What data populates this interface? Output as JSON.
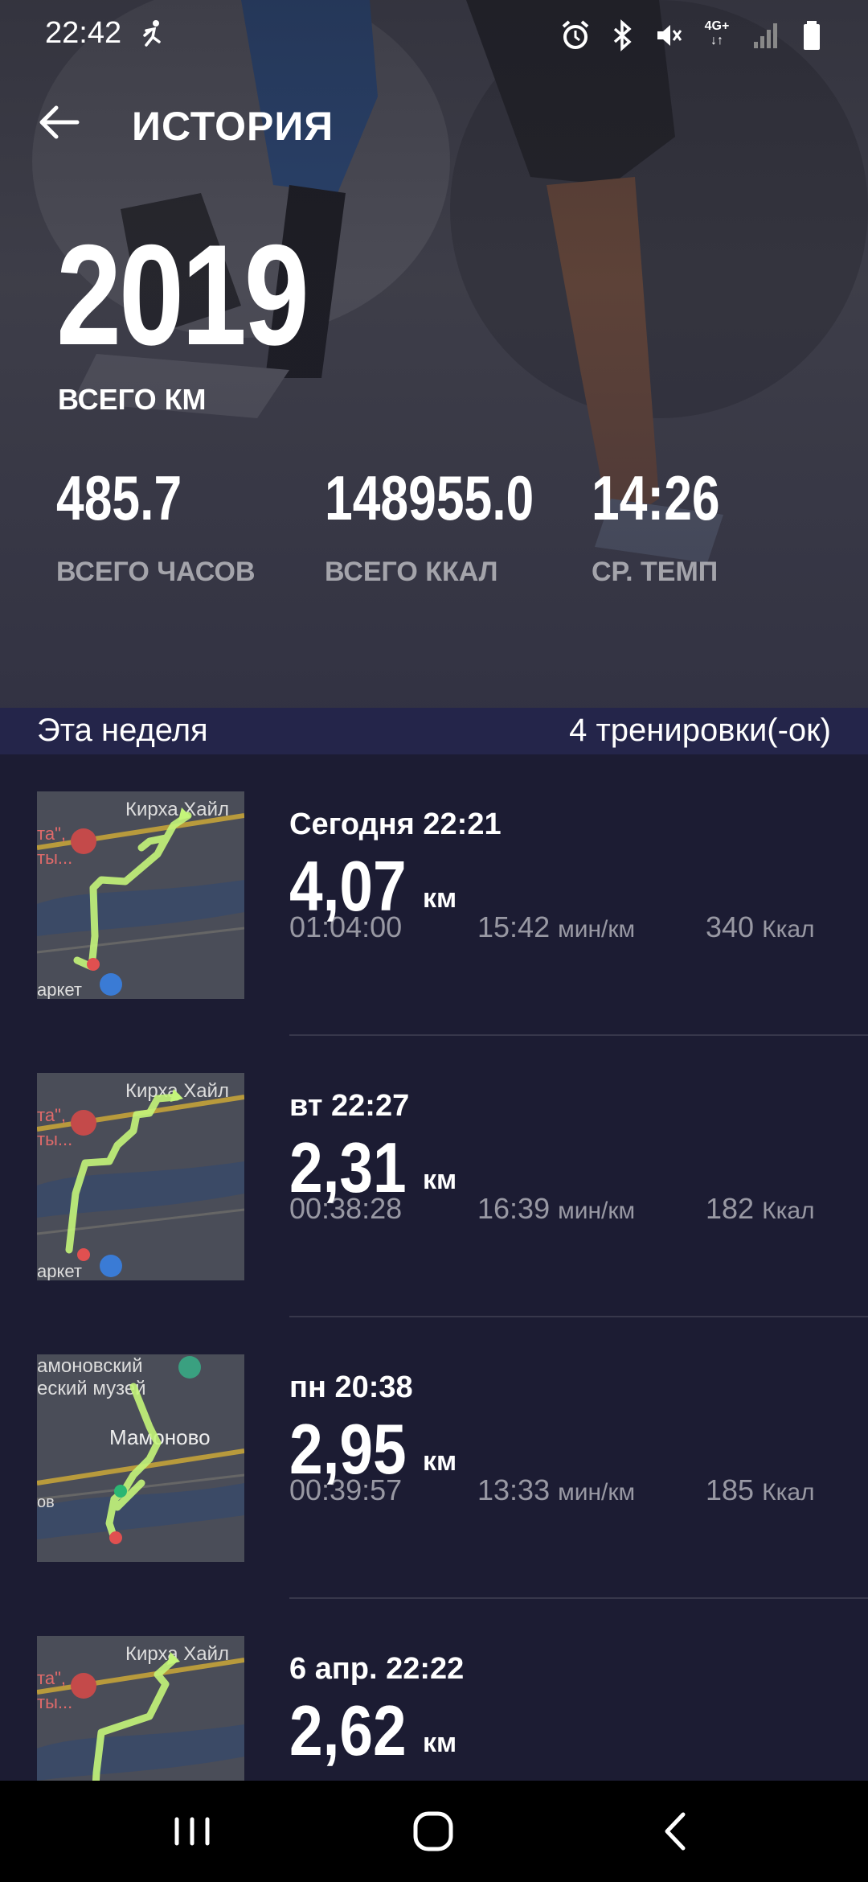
{
  "status_bar": {
    "time": "22:42",
    "network": "4G+",
    "icons": [
      "running-icon",
      "alarm-icon",
      "bluetooth-icon",
      "mute-icon",
      "signal-icon",
      "battery-icon"
    ]
  },
  "header": {
    "title": "ИСТОРИЯ",
    "year": "2019",
    "year_label": "ВСЕГО КМ",
    "stats": [
      {
        "value": "485.7",
        "label": "ВСЕГО ЧАСОВ"
      },
      {
        "value": "148955.0",
        "label": "ВСЕГО ККАЛ"
      },
      {
        "value": "14:26",
        "label": "СР. ТЕМП"
      }
    ]
  },
  "week": {
    "title": "Эта неделя",
    "count": "4 тренировки(-ок)"
  },
  "workouts": [
    {
      "date": "Сегодня 22:21",
      "distance": "4,07",
      "unit": "км",
      "duration": "01:04:00",
      "pace": "15:42",
      "pace_unit": "мин/км",
      "kcal": "340",
      "kcal_unit": "Ккал"
    },
    {
      "date": "вт 22:27",
      "distance": "2,31",
      "unit": "км",
      "duration": "00:38:28",
      "pace": "16:39",
      "pace_unit": "мин/км",
      "kcal": "182",
      "kcal_unit": "Ккал"
    },
    {
      "date": "пн 20:38",
      "distance": "2,95",
      "unit": "км",
      "duration": "00:39:57",
      "pace": "13:33",
      "pace_unit": "мин/км",
      "kcal": "185",
      "kcal_unit": "Ккал"
    },
    {
      "date": "6 апр. 22:22",
      "distance": "2,62",
      "unit": "км"
    }
  ],
  "map_labels": {
    "a": "Кирха Хайл",
    "b": "та\",",
    "c": "ты...",
    "d": "аркет",
    "e": "амоновский",
    "f": "еский музей",
    "g": "Мамоново",
    "h": "ов"
  },
  "colors": {
    "accent": "#c4f57a",
    "background": "#1c1c33",
    "week_header": "#24254a"
  }
}
